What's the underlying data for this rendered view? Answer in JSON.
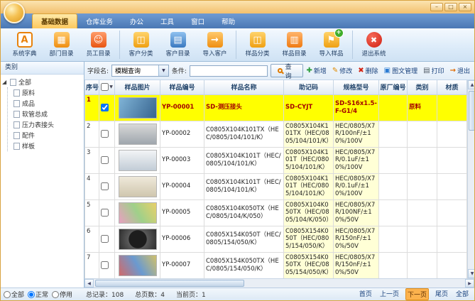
{
  "window": {
    "minimize": "–",
    "maximize": "□",
    "close": "×"
  },
  "menu": {
    "tabs": [
      {
        "label": "基础数据"
      },
      {
        "label": "仓库业务"
      },
      {
        "label": "办公"
      },
      {
        "label": "工具"
      },
      {
        "label": "窗口"
      },
      {
        "label": "帮助"
      }
    ]
  },
  "toolbar": {
    "items": [
      {
        "label": "系统字典",
        "icon": "system-dictionary-icon"
      },
      {
        "label": "部门目录",
        "icon": "department-directory-icon"
      },
      {
        "label": "员工目录",
        "icon": "employee-directory-icon"
      },
      {
        "label": "客户分类",
        "icon": "customer-category-icon"
      },
      {
        "label": "客户目录",
        "icon": "customer-directory-icon"
      },
      {
        "label": "导入客户",
        "icon": "import-customer-icon"
      },
      {
        "label": "样品分类",
        "icon": "sample-category-icon"
      },
      {
        "label": "样品目录",
        "icon": "sample-directory-icon"
      },
      {
        "label": "导入样品",
        "icon": "import-sample-icon"
      },
      {
        "label": "退出系统",
        "icon": "exit-system-icon"
      }
    ]
  },
  "sidebar": {
    "title": "类别",
    "tree_root": "全部",
    "tree_items": [
      "原料",
      "成品",
      "软管总成",
      "压力表接头",
      "配件",
      "样板"
    ]
  },
  "filters": [
    {
      "label": "全部"
    },
    {
      "label": "正常",
      "checked": "checked"
    },
    {
      "label": "停用"
    }
  ],
  "search": {
    "field_label": "字段名:",
    "field_value": "模糊查询",
    "condition_label": "条件:",
    "button": "查询"
  },
  "actions": [
    {
      "label": "新增",
      "icon": "add-icon"
    },
    {
      "label": "修改",
      "icon": "edit-icon"
    },
    {
      "label": "删除",
      "icon": "delete-icon"
    },
    {
      "label": "图文管理",
      "icon": "image-manage-icon"
    },
    {
      "label": "打印",
      "icon": "print-icon"
    },
    {
      "label": "退出",
      "icon": "exit-icon"
    }
  ],
  "table": {
    "headers": {
      "no": "序号",
      "image": "样品图片",
      "code": "样品编号",
      "name": "样品名称",
      "mnemonic": "助记码",
      "spec": "规格型号",
      "factory": "原厂编号",
      "category": "类别",
      "material": "材质"
    },
    "rows": [
      {
        "no": "1",
        "checked": "checked",
        "code": "YP-00001",
        "name": "SD-测压接头",
        "mnemonic": "SD-CYJT",
        "spec": "SD-S16x1.5-F-G1/4",
        "factory": "",
        "category": "原料",
        "material": ""
      },
      {
        "no": "2",
        "code": "YP-00002",
        "name": "C0805X104K101TX（HEC/0805/104/101/K）",
        "mnemonic": "C0805X104K101TX（HEC/0805/104/101/K）",
        "spec": "HEC/0805/X7R/100nF/±10%/100V",
        "factory": "",
        "category": "",
        "material": ""
      },
      {
        "no": "3",
        "code": "YP-00003",
        "name": "C0805X104K101T（HEC/0805/104/101/K）",
        "mnemonic": "C0805X104K101T（HEC/0805/104/101/K）",
        "spec": "HEC/0805/X7R/0.1uF/±10%/100V",
        "factory": "",
        "category": "",
        "material": ""
      },
      {
        "no": "4",
        "code": "YP-00004",
        "name": "C0805X104K101T（HEC/0805/104/101/K）",
        "mnemonic": "C0805X104K101T（HEC/0805/104/101/K）",
        "spec": "HEC/0805/X7R/0.1uF/±10%/100V",
        "factory": "",
        "category": "",
        "material": ""
      },
      {
        "no": "5",
        "code": "YP-00005",
        "name": "C0805X104K050TX（HEC/0805/104/K/050）",
        "mnemonic": "C0805X104K050TX（HEC/0805/104/K/050）",
        "spec": "HEC/0805/X7R/100NF/±10%/50V",
        "factory": "",
        "category": "",
        "material": ""
      },
      {
        "no": "6",
        "code": "YP-00006",
        "name": "C0805X154K050T（HEC/0805/154/050/K）",
        "mnemonic": "C0805X154K050T（HEC/0805/154/050/K）",
        "spec": "HEC/0805/X7R/150nF/±10%/50V",
        "factory": "",
        "category": "",
        "material": ""
      },
      {
        "no": "7",
        "code": "YP-00007",
        "name": "C0805X154K050TX（HEC/0805/154/050/K）",
        "mnemonic": "C0805X154K050TX（HEC/0805/154/050/K）",
        "spec": "HEC/0805/X7R/150nF/±10%/50V",
        "factory": "",
        "category": "",
        "material": ""
      }
    ]
  },
  "status": {
    "records_label": "总记录：",
    "records": "108",
    "pages_label": "总页数：",
    "pages": "4",
    "current_label": "当前页：",
    "current": "1"
  },
  "pagination": [
    {
      "label": "首页"
    },
    {
      "label": "上一页"
    },
    {
      "label": "下一页"
    },
    {
      "label": "尾页"
    },
    {
      "label": "全部"
    }
  ],
  "colors": {
    "accent_orange": "#fcc95e",
    "selection_yellow": "#ffff00",
    "selected_text": "#a40000",
    "column_highlight": "#ffffd6",
    "ribbon_blue": "#4a78b4"
  }
}
